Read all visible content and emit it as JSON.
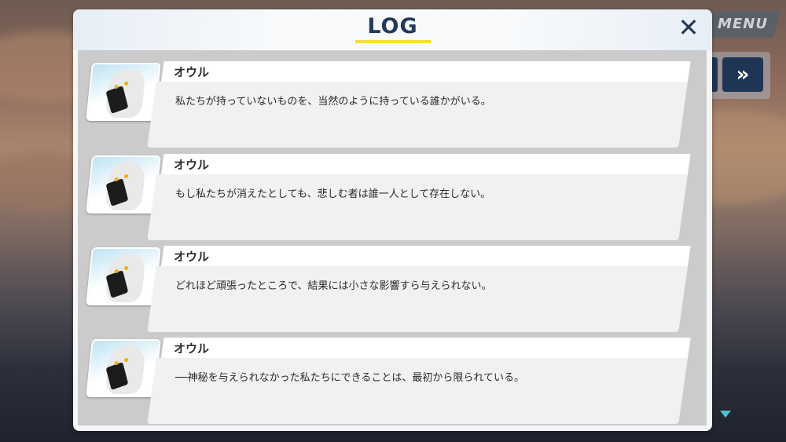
{
  "menu": {
    "label": "MENU"
  },
  "controls": {
    "skip_label": "»"
  },
  "dialog": {
    "title": "LOG",
    "close_label": "✕"
  },
  "log": {
    "entries": [
      {
        "speaker": "オウル",
        "text": "私たちが持っていないものを、当然のように持っている誰かがいる。"
      },
      {
        "speaker": "オウル",
        "text": "もし私たちが消えたとしても、悲しむ者は誰一人として存在しない。"
      },
      {
        "speaker": "オウル",
        "text": "どれほど頑張ったところで、結果には小さな影響すら与えられない。"
      },
      {
        "speaker": "オウル",
        "text": "──神秘を与えられなかった私たちにできることは、最初から限られている。"
      }
    ]
  },
  "colors": {
    "title": "#243a5a",
    "accent": "#f2df3a",
    "button_dark": "#1e3556",
    "scroll_indicator": "#4fc1d4"
  }
}
